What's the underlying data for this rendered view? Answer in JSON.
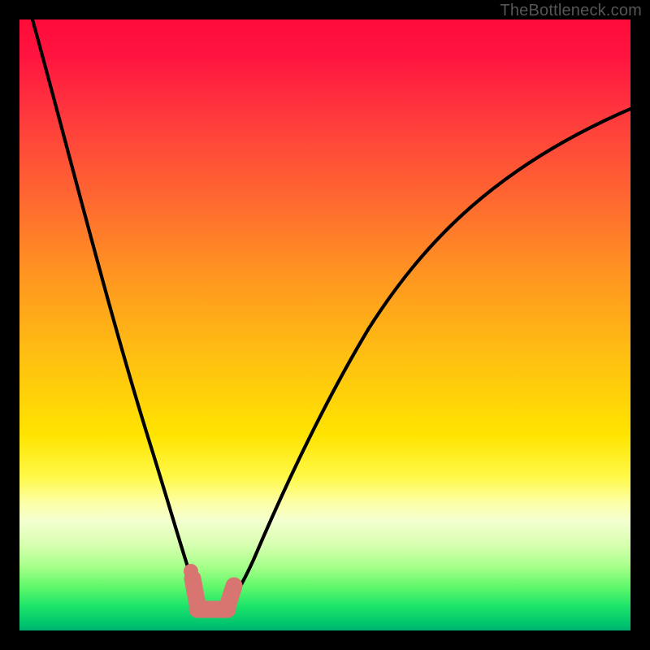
{
  "attribution": "TheBottleneck.com",
  "colors": {
    "frame": "#000000",
    "curve": "#000000",
    "highlight": "#d97571",
    "highlight_cap": "#d97571"
  },
  "chart_data": {
    "type": "line",
    "title": "",
    "xlabel": "",
    "ylabel": "",
    "xlim": [
      0,
      100
    ],
    "ylim": [
      0,
      100
    ],
    "grid": false,
    "annotations": [
      "TheBottleneck.com"
    ],
    "series": [
      {
        "name": "bottleneck-curve",
        "x": [
          0,
          3,
          6,
          9,
          12,
          15,
          18,
          21,
          23,
          25,
          27,
          28.5,
          30,
          31.5,
          33,
          35,
          38,
          42,
          47,
          53,
          60,
          68,
          77,
          87,
          100
        ],
        "y": [
          100,
          90,
          80,
          70,
          60,
          50,
          40,
          28,
          18,
          8,
          2,
          0,
          0,
          0,
          2,
          7,
          15,
          25,
          36,
          46,
          55,
          62,
          68,
          73,
          78
        ]
      }
    ],
    "highlight_region": {
      "x_start": 27.5,
      "x_end": 33,
      "y": 0,
      "description": "optimal-range"
    }
  }
}
